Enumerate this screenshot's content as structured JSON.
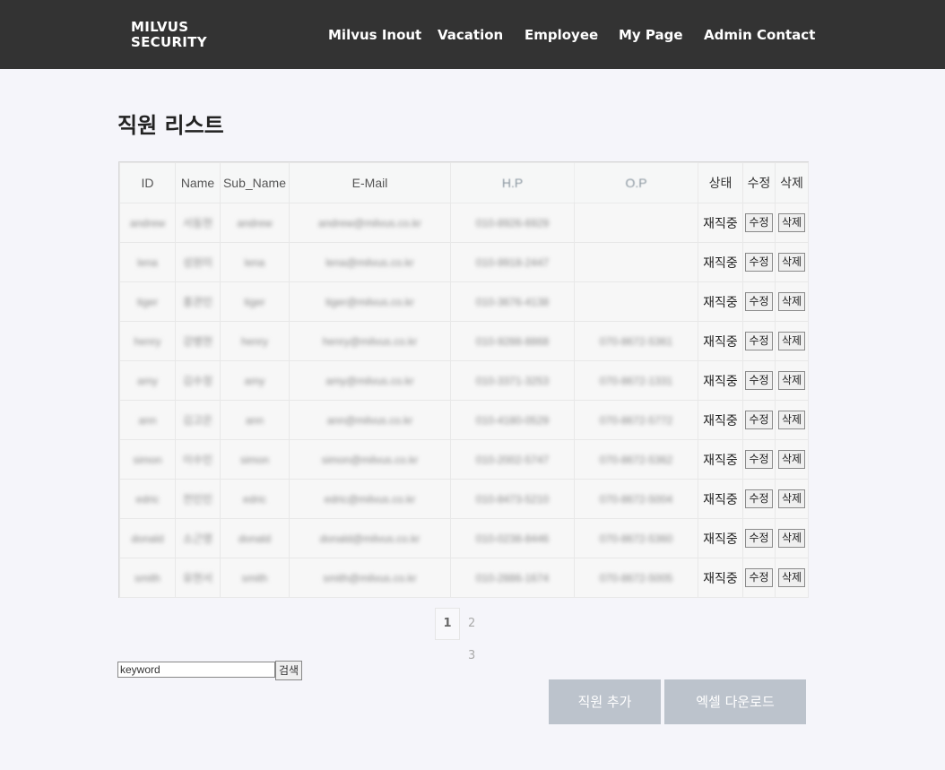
{
  "header": {
    "brand_line1": "MILVUS",
    "brand_line2": "SECURITY",
    "nav": [
      "Milvus Inout",
      "Vacation",
      "Employee",
      "My Page",
      "Admin Contact"
    ]
  },
  "page": {
    "title": "직원 리스트"
  },
  "table": {
    "columns": [
      "ID",
      "Name",
      "Sub_Name",
      "E-Mail",
      "H.P",
      "O.P",
      "상태",
      "수정",
      "삭제"
    ],
    "edit_label": "수정",
    "delete_label": "삭제",
    "rows": [
      {
        "id": "andrew",
        "name": "서동현",
        "sub": "andrew",
        "email": "andrew@milvus.co.kr",
        "hp": "010-8926-6929",
        "op": "",
        "status": "재직중"
      },
      {
        "id": "lena",
        "name": "성원미",
        "sub": "lena",
        "email": "lena@milvus.co.kr",
        "hp": "010-9918-2447",
        "op": "",
        "status": "재직중"
      },
      {
        "id": "tiger",
        "name": "홍관민",
        "sub": "tiger",
        "email": "tiger@milvus.co.kr",
        "hp": "010-3676-4138",
        "op": "",
        "status": "재직중"
      },
      {
        "id": "henry",
        "name": "강병현",
        "sub": "henry",
        "email": "henry@milvus.co.kr",
        "hp": "010-9288-8868",
        "op": "070-8672-5361",
        "status": "재직중"
      },
      {
        "id": "amy",
        "name": "김수정",
        "sub": "amy",
        "email": "amy@milvus.co.kr",
        "hp": "010-3371-3253",
        "op": "070-8672-1331",
        "status": "재직중"
      },
      {
        "id": "ann",
        "name": "김고은",
        "sub": "ann",
        "email": "ann@milvus.co.kr",
        "hp": "010-4180-0529",
        "op": "070-8672-5772",
        "status": "재직중"
      },
      {
        "id": "simon",
        "name": "이수민",
        "sub": "simon",
        "email": "simon@milvus.co.kr",
        "hp": "010-2002-5747",
        "op": "070-8672-5362",
        "status": "재직중"
      },
      {
        "id": "edric",
        "name": "전민민",
        "sub": "edric",
        "email": "edric@milvus.co.kr",
        "hp": "010-8473-5210",
        "op": "070-8672-5004",
        "status": "재직중"
      },
      {
        "id": "donald",
        "name": "소근영",
        "sub": "donald",
        "email": "donald@milvus.co.kr",
        "hp": "010-0238-8446",
        "op": "070-8672-5360",
        "status": "재직중"
      },
      {
        "id": "smith",
        "name": "유현서",
        "sub": "smith",
        "email": "smith@milvus.co.kr",
        "hp": "010-2886-1674",
        "op": "070-8672-5005",
        "status": "재직중"
      }
    ]
  },
  "pagination": {
    "current": "1",
    "others": "2 3"
  },
  "search": {
    "placeholder": "keyword",
    "button": "검색"
  },
  "actions": {
    "add_employee": "직원 추가",
    "excel_download": "엑셀 다운로드"
  },
  "colors": {
    "header_bg": "#333333",
    "page_bg": "#f5f5fa",
    "action_button_bg": "#bcc3cc"
  }
}
